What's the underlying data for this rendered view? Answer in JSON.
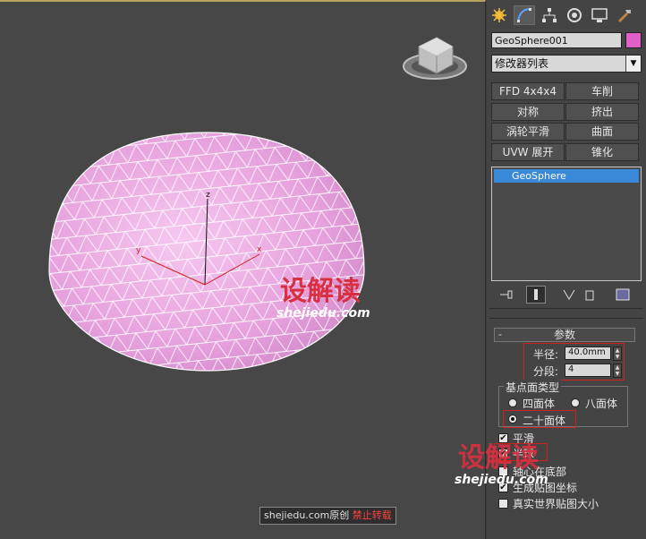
{
  "toolbar": {
    "icons": [
      "create-icon",
      "modify-icon",
      "hierarchy-icon",
      "motion-icon",
      "display-icon",
      "utilities-icon"
    ]
  },
  "object": {
    "name": "GeoSphere001",
    "color": "#e060c8"
  },
  "modifier_list": {
    "label": "修改器列表"
  },
  "modifier_buttons": [
    "FFD 4x4x4",
    "车削",
    "对称",
    "挤出",
    "涡轮平滑",
    "曲面",
    "UVW 展开",
    "锥化"
  ],
  "stack": {
    "items": [
      "GeoSphere"
    ]
  },
  "params": {
    "rollout_title": "参数",
    "radius_label": "半径:",
    "radius_value": "40.0mm",
    "segments_label": "分段:",
    "segments_value": "4",
    "base_type_label": "基点面类型",
    "tetra_label": "四面体",
    "octa_label": "八面体",
    "icosa_label": "二十面体",
    "smooth_label": "平滑",
    "hemisphere_label": "半球",
    "base_pivot_label": "轴心在底部",
    "gen_map_label": "生成贴图坐标",
    "real_world_label": "真实世界贴图大小",
    "collapse_mark": "-"
  },
  "watermark": {
    "logo": "设解读",
    "url": "shejiedu.com",
    "footer_site": "shejiedu.com原创",
    "footer_warning": "禁止转载"
  },
  "viewport": {
    "axis_x": "x",
    "axis_y": "y",
    "axis_z": "z",
    "sphere_color": "#e6a6de"
  }
}
